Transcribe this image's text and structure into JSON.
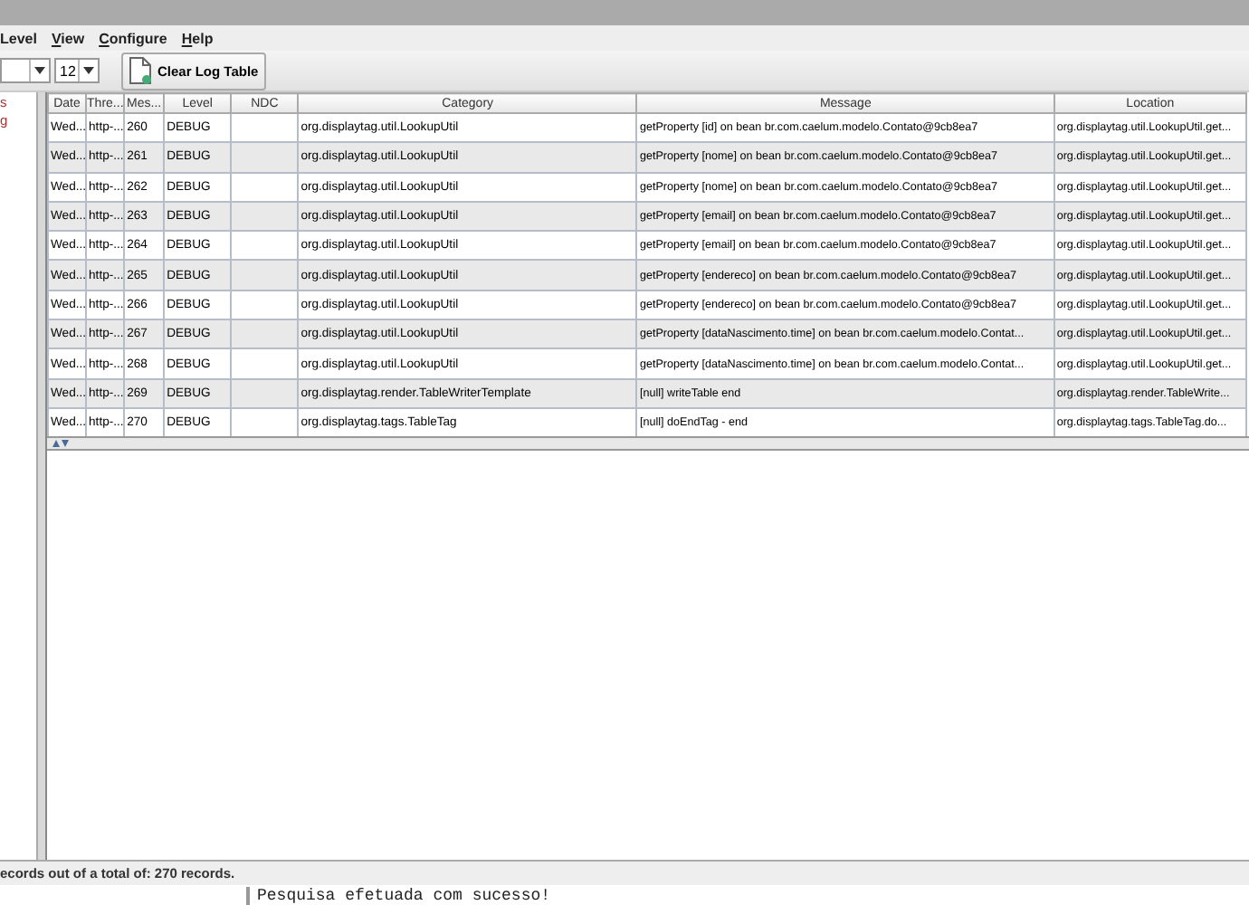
{
  "menu": [
    {
      "label": "Level"
    },
    {
      "label": "View"
    },
    {
      "label": "Configure"
    },
    {
      "label": "Help"
    }
  ],
  "toolbar": {
    "font_size": "12",
    "clear_button": "Clear Log Table"
  },
  "sidebar": {
    "items": [
      "s",
      "g"
    ]
  },
  "table": {
    "columns": [
      "Date",
      "Thre...",
      "Mes...",
      "Level",
      "NDC",
      "Category",
      "Message",
      "Location"
    ],
    "rows": [
      [
        "Wed...",
        "http-...",
        "260",
        "DEBUG",
        "",
        "org.displaytag.util.LookupUtil",
        "getProperty [id] on bean br.com.caelum.modelo.Contato@9cb8ea7",
        "org.displaytag.util.LookupUtil.get..."
      ],
      [
        "Wed...",
        "http-...",
        "261",
        "DEBUG",
        "",
        "org.displaytag.util.LookupUtil",
        "getProperty [nome] on bean br.com.caelum.modelo.Contato@9cb8ea7",
        "org.displaytag.util.LookupUtil.get..."
      ],
      [
        "Wed...",
        "http-...",
        "262",
        "DEBUG",
        "",
        "org.displaytag.util.LookupUtil",
        "getProperty [nome] on bean br.com.caelum.modelo.Contato@9cb8ea7",
        "org.displaytag.util.LookupUtil.get..."
      ],
      [
        "Wed...",
        "http-...",
        "263",
        "DEBUG",
        "",
        "org.displaytag.util.LookupUtil",
        "getProperty [email] on bean br.com.caelum.modelo.Contato@9cb8ea7",
        "org.displaytag.util.LookupUtil.get..."
      ],
      [
        "Wed...",
        "http-...",
        "264",
        "DEBUG",
        "",
        "org.displaytag.util.LookupUtil",
        "getProperty [email] on bean br.com.caelum.modelo.Contato@9cb8ea7",
        "org.displaytag.util.LookupUtil.get..."
      ],
      [
        "Wed...",
        "http-...",
        "265",
        "DEBUG",
        "",
        "org.displaytag.util.LookupUtil",
        "getProperty [endereco] on bean br.com.caelum.modelo.Contato@9cb8ea7",
        "org.displaytag.util.LookupUtil.get..."
      ],
      [
        "Wed...",
        "http-...",
        "266",
        "DEBUG",
        "",
        "org.displaytag.util.LookupUtil",
        "getProperty [endereco] on bean br.com.caelum.modelo.Contato@9cb8ea7",
        "org.displaytag.util.LookupUtil.get..."
      ],
      [
        "Wed...",
        "http-...",
        "267",
        "DEBUG",
        "",
        "org.displaytag.util.LookupUtil",
        "getProperty [dataNascimento.time] on bean br.com.caelum.modelo.Contat...",
        "org.displaytag.util.LookupUtil.get..."
      ],
      [
        "Wed...",
        "http-...",
        "268",
        "DEBUG",
        "",
        "org.displaytag.util.LookupUtil",
        "getProperty [dataNascimento.time] on bean br.com.caelum.modelo.Contat...",
        "org.displaytag.util.LookupUtil.get..."
      ],
      [
        "Wed...",
        "http-...",
        "269",
        "DEBUG",
        "",
        "org.displaytag.render.TableWriterTemplate",
        "[null] writeTable end",
        "org.displaytag.render.TableWrite..."
      ],
      [
        "Wed...",
        "http-...",
        "270",
        "DEBUG",
        "",
        "org.displaytag.tags.TableTag",
        "[null] doEndTag - end",
        "org.displaytag.tags.TableTag.do..."
      ]
    ]
  },
  "status_bar": "ecords out of a total of: 270 records.",
  "console_text": "Pesquisa efetuada com sucesso!"
}
